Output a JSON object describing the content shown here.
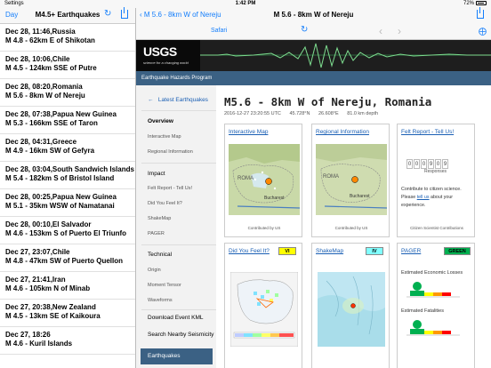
{
  "status_bar": {
    "left": "Settings",
    "time": "1:42 PM",
    "battery": "72%"
  },
  "left_nav": {
    "back": "Day",
    "title": "M4.5+ Earthquakes"
  },
  "quakes": [
    {
      "when": "Dec 28, 11:46,Russia",
      "desc": "M 4.8 - 62km E of Shikotan"
    },
    {
      "when": "Dec 28, 10:06,Chile",
      "desc": "M 4.5 - 124km SSE of Putre"
    },
    {
      "when": "Dec 28, 08:20,Romania",
      "desc": "M 5.6 - 8km W of Nereju"
    },
    {
      "when": "Dec 28, 07:38,Papua New Guinea",
      "desc": "M 5.3 - 166km SSE of Taron"
    },
    {
      "when": "Dec 28, 04:31,Greece",
      "desc": "M 4.9 - 16km SW of Gefyra"
    },
    {
      "when": "Dec 28, 03:04,South Sandwich Islands",
      "desc": "M 5.4 - 182km S of Bristol Island"
    },
    {
      "when": "Dec 28, 00:25,Papua New Guinea",
      "desc": "M 5.1 - 35km WSW of Namatanai"
    },
    {
      "when": "Dec 28, 00:10,El Salvador",
      "desc": "M 4.6 - 153km S of Puerto El Triunfo"
    },
    {
      "when": "Dec 27, 23:07,Chile",
      "desc": "M 4.8 - 47km SW of Puerto Quellon"
    },
    {
      "when": "Dec 27, 21:41,Iran",
      "desc": "M 4.6 - 105km N of Minab"
    },
    {
      "when": "Dec 27, 20:38,New Zealand",
      "desc": "M 4.5 - 13km SE of Kaikoura"
    },
    {
      "when": "Dec 27, 18:26",
      "desc": "M 4.6 - Kuril Islands"
    }
  ],
  "right_nav": {
    "back": "M 5.6 - 8km W of Nereju",
    "title": "M 5.6 - 8km W of Nereju"
  },
  "browser": {
    "label": "Safari"
  },
  "banner": {
    "logo": "USGS",
    "tagline": "science for a changing world"
  },
  "program": "Earthquake Hazards Program",
  "sidebar": {
    "back": "Latest Earthquakes",
    "overview": "Overview",
    "interactive_map": "Interactive Map",
    "regional_info": "Regional Information",
    "impact": "Impact",
    "felt_report": "Felt Report - Tell Us!",
    "dyfi": "Did You Feel It?",
    "shakemap": "ShakeMap",
    "pager": "PAGER",
    "technical": "Technical",
    "origin": "Origin",
    "moment_tensor": "Moment Tensor",
    "waveforms": "Waveforms",
    "download": "Download Event KML",
    "nearby": "Search Nearby Seismicity",
    "earthquakes": "Earthquakes"
  },
  "event": {
    "title": "M5.6 - 8km W of Nereju, Romania",
    "time": "2016-12-27 23:20:55 UTC",
    "lat": "45.728°N",
    "lon": "26.608°E",
    "depth": "81.0 km depth"
  },
  "cards": {
    "interactive_map": {
      "title": "Interactive Map",
      "contrib": "Contributed by US"
    },
    "regional_info": {
      "title": "Regional Information",
      "contrib": "Contributed by US"
    },
    "felt_report": {
      "title": "Felt Report - Tell Us!",
      "digits": [
        "0",
        "0",
        "0",
        "9",
        "0",
        "9"
      ],
      "responses": "Responses",
      "line1": "Contribute to citizen science.",
      "line2a": "Please",
      "line2b": "tell us",
      "line2c": "about your",
      "line3": "experience.",
      "contrib": "Citizen Scientist Contributions"
    },
    "dyfi": {
      "title": "Did You Feel It?",
      "badge": "VI",
      "badge_color": "#ffff00"
    },
    "shakemap": {
      "title": "ShakeMap",
      "badge": "IV",
      "badge_color": "#80ffff"
    },
    "pager": {
      "title": "PAGER",
      "badge": "GREEN",
      "badge_color": "#00b050",
      "losses": "Estimated Economic Losses",
      "fatalities": "Estimated Fatalities"
    }
  },
  "map_labels": {
    "country": "ROMA",
    "city": "Bucharest"
  }
}
